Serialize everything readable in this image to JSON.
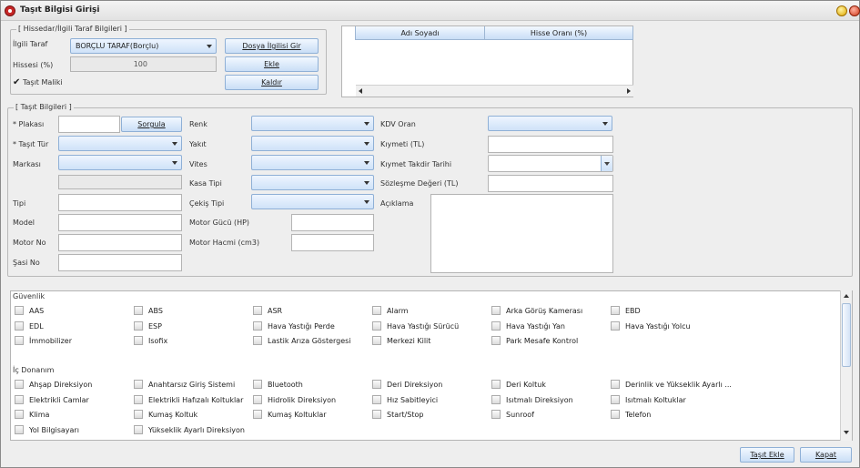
{
  "window": {
    "title": "Taşıt Bilgisi Girişi"
  },
  "hissedar": {
    "group_title": "Hissedar/İlgili Taraf Bilgileri",
    "ilgili_taraf_label": "İlgili Taraf",
    "ilgili_taraf_value": "BORÇLU TARAF(Borçlu)",
    "hissesi_label": "Hissesi (%)",
    "hissesi_value": "100",
    "tasit_maliki_label": "Taşıt Maliki",
    "dosya_button": "Dosya İlgilisi Gir",
    "ekle_button": "Ekle",
    "kaldir_button": "Kaldır",
    "table_headers": [
      "Adı Soyadı",
      "Hisse Oranı (%)"
    ]
  },
  "tasit": {
    "group_title": "Taşıt Bilgileri",
    "plakasi": "* Plakası",
    "sorgula": "Sorgula",
    "tasit_tur": "* Taşıt Tür",
    "markasi": "Markası",
    "tipi": "Tipi",
    "model": "Model",
    "motor_no": "Motor No",
    "sasi_no": "Şasi No",
    "renk": "Renk",
    "yakit": "Yakıt",
    "vites": "Vites",
    "kasa_tipi": "Kasa Tipi",
    "cekis_tipi": "Çekiş Tipi",
    "motor_gucu": "Motor Gücü (HP)",
    "motor_hacmi": "Motor Hacmi (cm3)",
    "kdv_oran": "KDV Oran",
    "kiymeti": "Kıymeti (TL)",
    "kiymet_tarih": "Kıymet Takdir Tarihi",
    "sozlesme": "Sözleşme Değeri (TL)",
    "aciklama": "Açıklama"
  },
  "features": {
    "guvenlik_title": "Güvenlik",
    "guvenlik": [
      "AAS",
      "ABS",
      "ASR",
      "Alarm",
      "Arka Görüş Kamerası",
      "EBD",
      "EDL",
      "ESP",
      "Hava Yastığı Perde",
      "Hava Yastığı Sürücü",
      "Hava Yastığı Yan",
      "Hava Yastığı Yolcu",
      "İmmobilizer",
      "Isofix",
      "Lastik Arıza Göstergesi",
      "Merkezi Kilit",
      "Park Mesafe Kontrol"
    ],
    "ic_donanim_title": "İç Donanım",
    "ic_donanim": [
      "Ahşap Direksiyon",
      "Anahtarsız Giriş Sistemi",
      "Bluetooth",
      "Deri Direksiyon",
      "Deri Koltuk",
      "Derinlik ve Yükseklik Ayarlı ...",
      "Elektrikli Camlar",
      "Elektrikli Hafızalı Koltuklar",
      "Hidrolik Direksiyon",
      "Hız Sabitleyici",
      "Isıtmalı Direksiyon",
      "Isıtmalı Koltuklar",
      "Klima",
      "Kumaş Koltuk",
      "Kumaş Koltuklar",
      "Start/Stop",
      "Sunroof",
      "Telefon",
      "Yol Bilgisayarı",
      "Yükseklik Ayarlı Direksiyon"
    ]
  },
  "footer": {
    "tasit_ekle": "Taşıt Ekle",
    "kapat": "Kapat"
  }
}
